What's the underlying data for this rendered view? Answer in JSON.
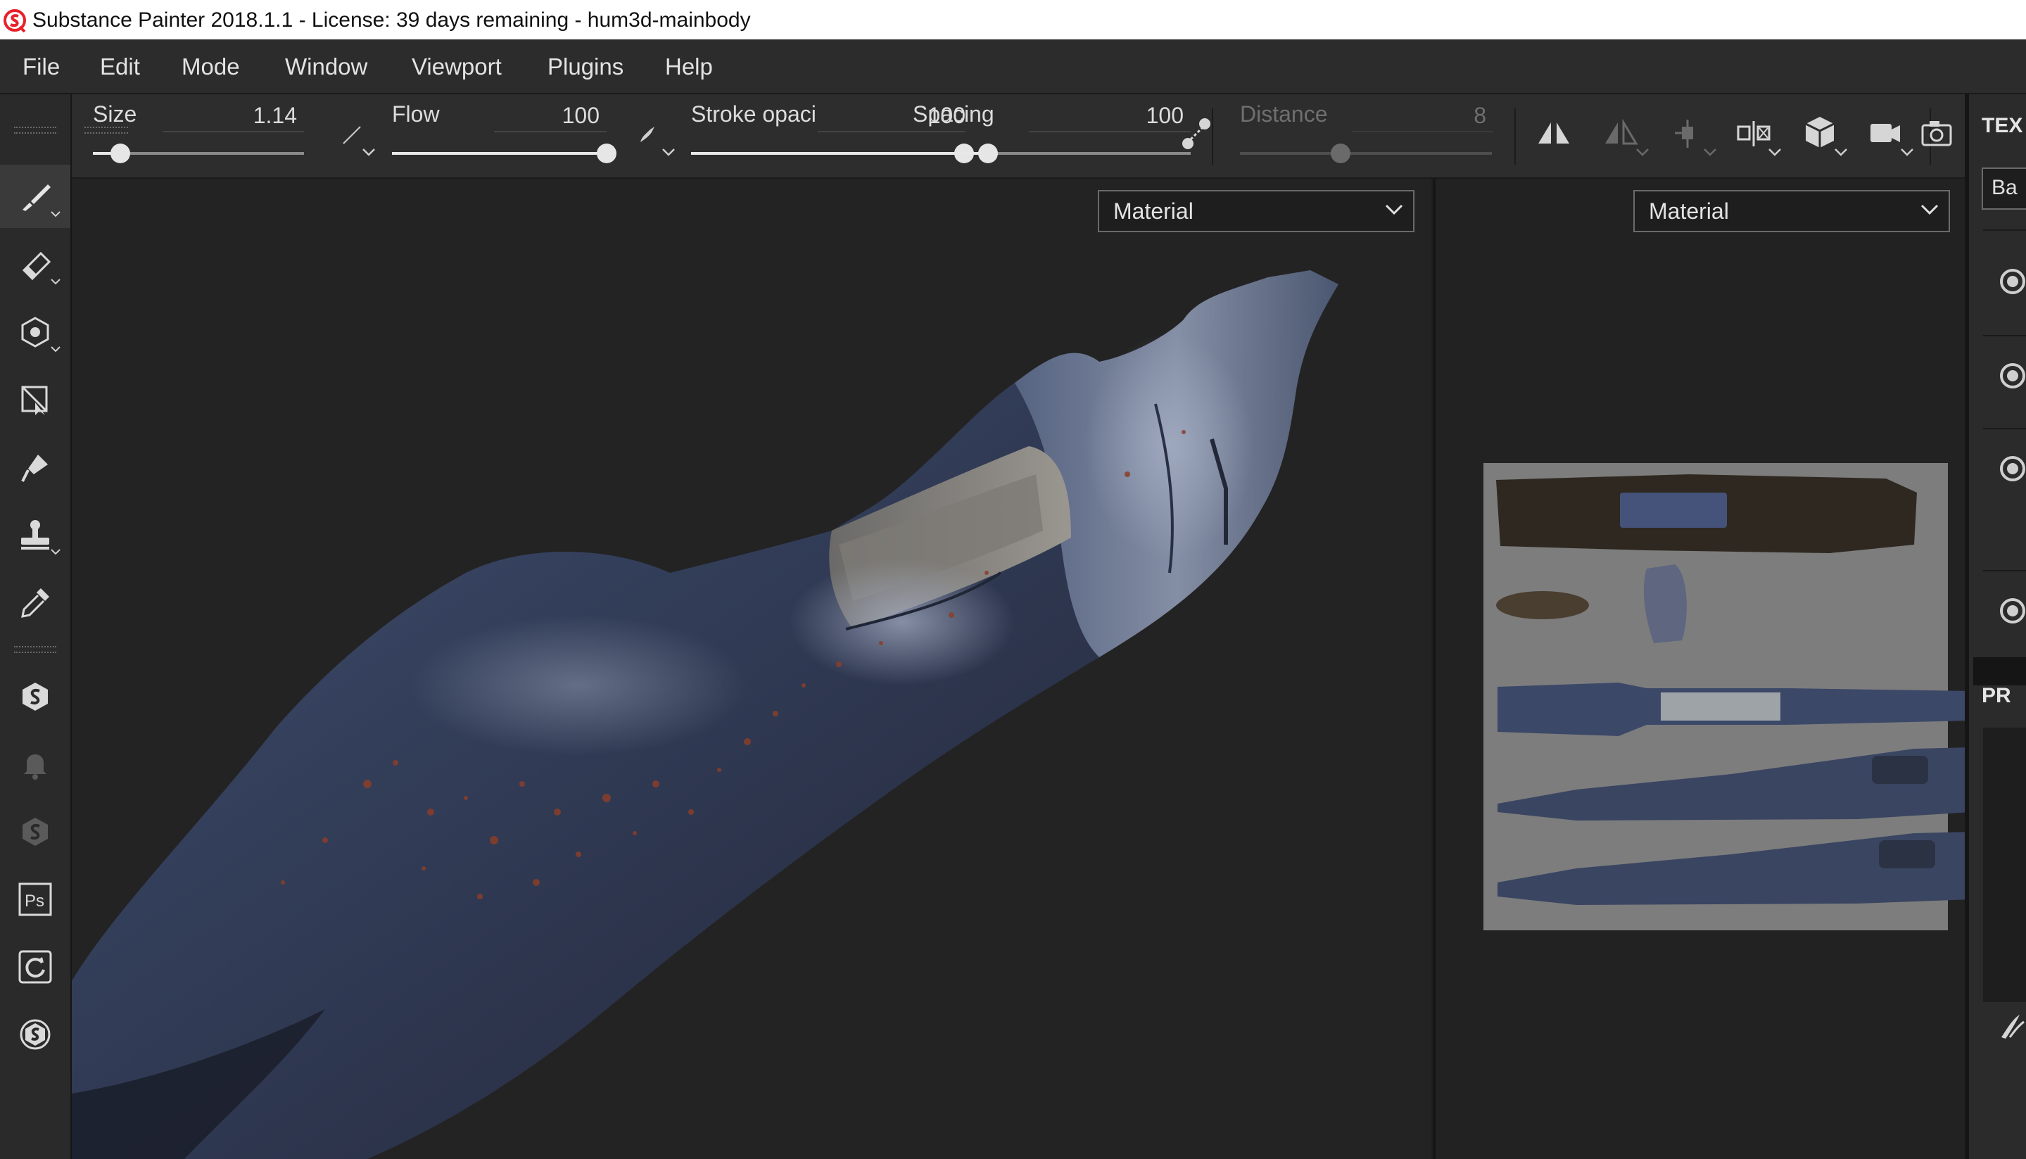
{
  "window": {
    "title": "Substance Painter 2018.1.1 - License: 39 days remaining - hum3d-mainbody",
    "logo_color": "#e8202a"
  },
  "menu": [
    "File",
    "Edit",
    "Mode",
    "Window",
    "Viewport",
    "Plugins",
    "Help"
  ],
  "tools": [
    {
      "name": "paint-brush-tool",
      "active": true
    },
    {
      "name": "eraser-tool"
    },
    {
      "name": "projection-tool"
    },
    {
      "name": "polygon-fill-tool"
    },
    {
      "name": "smudge-tool"
    },
    {
      "name": "clone-tool"
    },
    {
      "name": "color-picker-tool"
    },
    {
      "name": "substance-share-icon"
    },
    {
      "name": "notifications-icon"
    },
    {
      "name": "substance-source-icon"
    },
    {
      "name": "photoshop-icon"
    },
    {
      "name": "sync-icon"
    },
    {
      "name": "substance-icon"
    }
  ],
  "context_bar": {
    "size": {
      "label": "Size",
      "value": "1.14",
      "fraction": 0.13
    },
    "flow": {
      "label": "Flow",
      "value": "100",
      "fraction": 1.0
    },
    "stroke_opacity": {
      "label": "Stroke opaci",
      "value": "100",
      "fraction": 1.0
    },
    "spacing": {
      "label": "Spacing",
      "value": "100",
      "fraction": 0.27
    },
    "distance": {
      "label": "Distance",
      "value": "8",
      "fraction": 0.4,
      "disabled": true
    }
  },
  "toolbar_icons": [
    "symmetry-icon",
    "symmetry-settings-icon",
    "camera-pivot-icon",
    "viewport-split-icon",
    "display-mode-icon",
    "camera-icon",
    "screenshot-icon"
  ],
  "viewport3d": {
    "channel_select": "Material"
  },
  "viewport2d": {
    "channel_select": "Material"
  },
  "right_panel": {
    "title_top": "TEX",
    "input_value": "Ba",
    "title_mid": "PR"
  }
}
